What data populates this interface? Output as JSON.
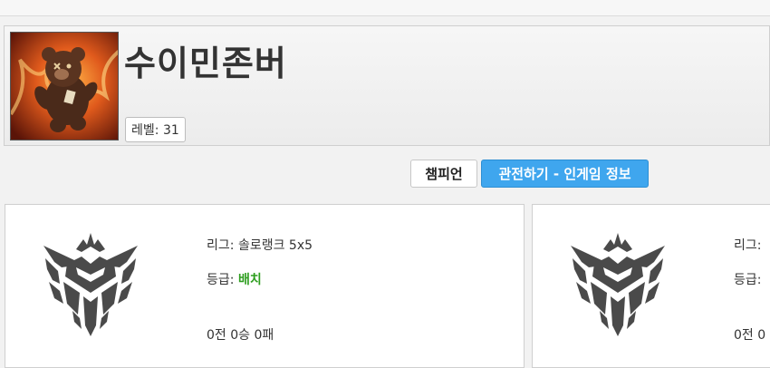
{
  "profile": {
    "name": "수이민존버",
    "level_label": "레벨:",
    "level_value": "31",
    "icon": "teddy-bear-fire-icon"
  },
  "buttons": {
    "champion_label": "챔피언",
    "spectate_label": "관전하기 - 인게임 정보"
  },
  "leagues": [
    {
      "league_label": "리그:",
      "league_value": "솔로랭크 5x5",
      "tier_label": "등급:",
      "tier_value": "배치",
      "record": "0전 0승 0패",
      "emblem_icon": "unranked-emblem-icon"
    },
    {
      "league_label": "리그:",
      "league_value": "",
      "tier_label": "등급:",
      "tier_value": "",
      "record": "0전 0",
      "emblem_icon": "unranked-emblem-icon"
    }
  ],
  "colors": {
    "accent_blue": "#3fa6ee",
    "tier_green": "#2e9e1f"
  }
}
